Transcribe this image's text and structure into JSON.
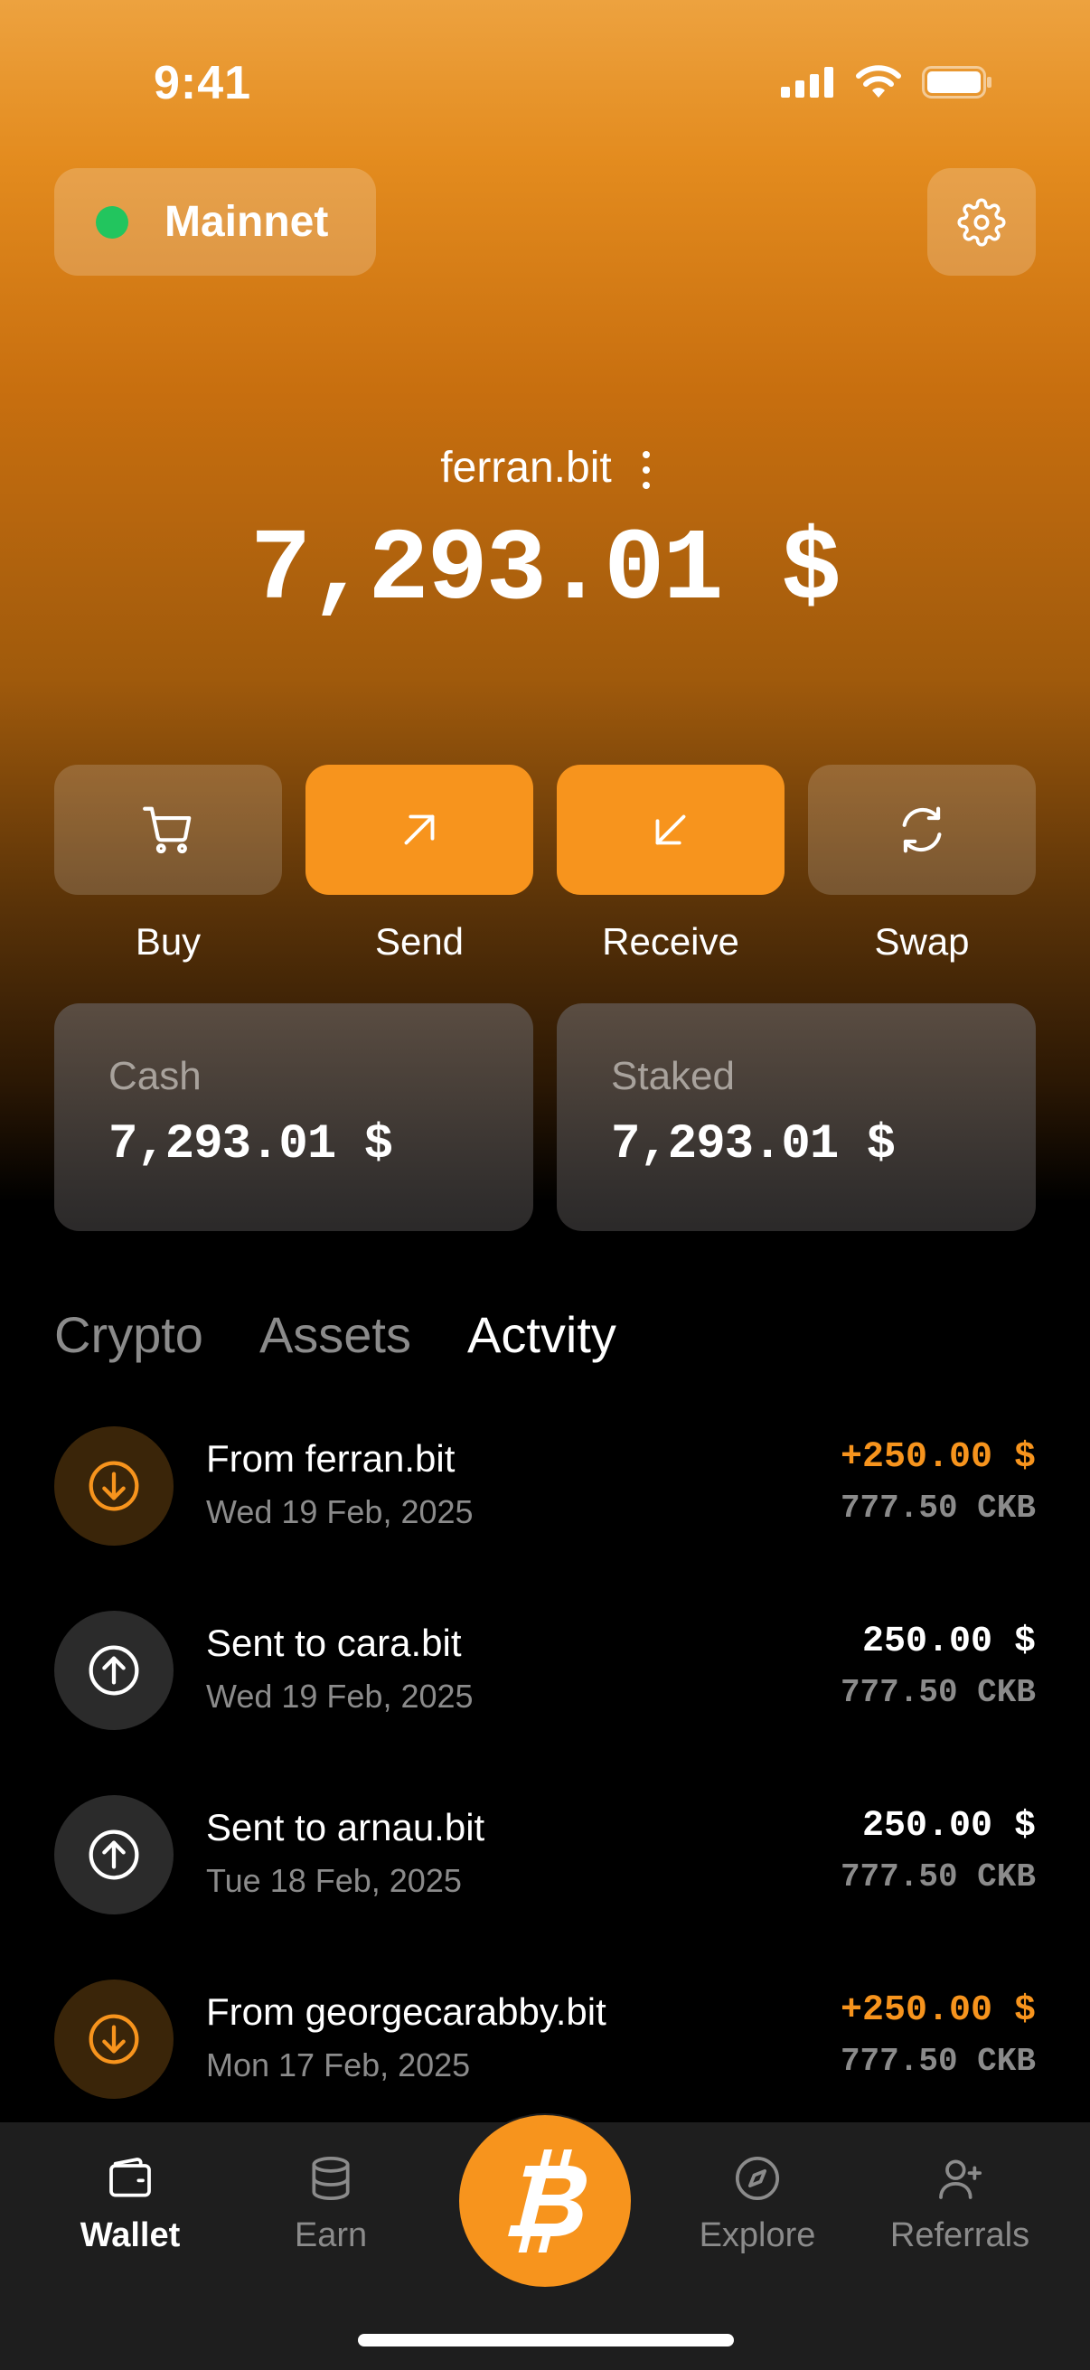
{
  "status_bar": {
    "time": "9:41"
  },
  "header": {
    "network_label": "Mainnet",
    "network_status_color": "#22c55e",
    "account_name": "ferran.bit",
    "balance": "7,293.01 $"
  },
  "actions": [
    {
      "label": "Buy",
      "icon": "cart-icon",
      "style": "dim"
    },
    {
      "label": "Send",
      "icon": "arrow-up-right-icon",
      "style": "accent"
    },
    {
      "label": "Receive",
      "icon": "arrow-down-left-icon",
      "style": "accent"
    },
    {
      "label": "Swap",
      "icon": "swap-icon",
      "style": "dim"
    }
  ],
  "summary": {
    "cash": {
      "label": "Cash",
      "value": "7,293.01 $"
    },
    "staked": {
      "label": "Staked",
      "value": "7,293.01 $"
    }
  },
  "tabs": [
    {
      "label": "Crypto",
      "active": false
    },
    {
      "label": "Assets",
      "active": false
    },
    {
      "label": "Actvity",
      "active": true
    }
  ],
  "activity": [
    {
      "direction": "in",
      "title": "From ferran.bit",
      "date": "Wed 19 Feb, 2025",
      "amount": "+250.00 $",
      "sub_amount": "777.50 CKB"
    },
    {
      "direction": "out",
      "title": "Sent to cara.bit",
      "date": "Wed 19 Feb, 2025",
      "amount": "250.00 $",
      "sub_amount": "777.50 CKB"
    },
    {
      "direction": "out",
      "title": "Sent to arnau.bit",
      "date": "Tue 18 Feb, 2025",
      "amount": "250.00 $",
      "sub_amount": "777.50 CKB"
    },
    {
      "direction": "in",
      "title": "From georgecarabby.bit",
      "date": "Mon 17 Feb, 2025",
      "amount": "+250.00 $",
      "sub_amount": "777.50 CKB"
    }
  ],
  "bottom_nav": [
    {
      "label": "Wallet",
      "icon": "wallet-icon",
      "active": true
    },
    {
      "label": "Earn",
      "icon": "database-icon",
      "active": false
    },
    {
      "label": "Explore",
      "icon": "compass-icon",
      "active": false
    },
    {
      "label": "Referrals",
      "icon": "user-plus-icon",
      "active": false
    }
  ],
  "center_button_icon": "bitcoin-icon",
  "colors": {
    "accent": "#f7941d",
    "background": "#000000",
    "gradient_top": "#eda23f"
  }
}
